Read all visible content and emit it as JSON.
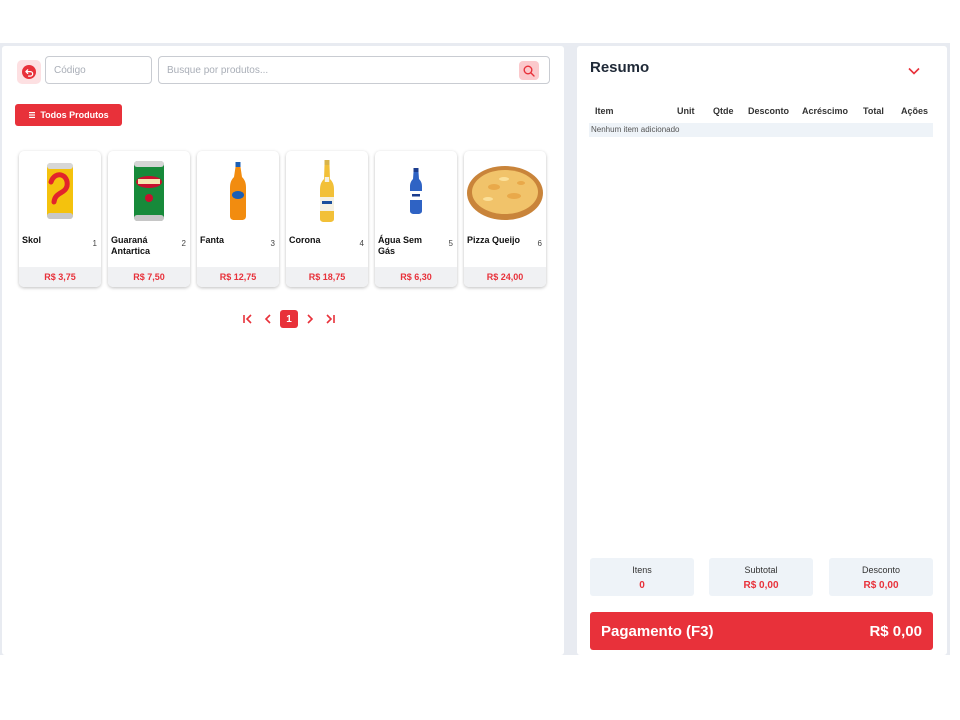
{
  "toolbar": {
    "code_placeholder": "Código",
    "search_placeholder": "Busque por produtos...",
    "all_products_label": "Todos Produtos"
  },
  "products": [
    {
      "name": "Skol",
      "code": "1",
      "price": "R$ 3,75",
      "icon": "skol-can-image"
    },
    {
      "name": "Guaraná Antartica",
      "code": "2",
      "price": "R$ 7,50",
      "icon": "guarana-can-image"
    },
    {
      "name": "Fanta",
      "code": "3",
      "price": "R$ 12,75",
      "icon": "fanta-bottle-image"
    },
    {
      "name": "Corona",
      "code": "4",
      "price": "R$ 18,75",
      "icon": "corona-bottle-image"
    },
    {
      "name": "Água Sem Gás",
      "code": "5",
      "price": "R$ 6,30",
      "icon": "water-bottle-image"
    },
    {
      "name": "Pizza Queijo",
      "code": "6",
      "price": "R$ 24,00",
      "icon": "pizza-image"
    }
  ],
  "pagination": {
    "current_page": "1"
  },
  "summary": {
    "title": "Resumo",
    "columns": [
      "Item",
      "Unit",
      "Qtde",
      "Desconto",
      "Acréscimo",
      "Total",
      "Ações"
    ],
    "empty_text": "Nenhum item adicionado",
    "stats": [
      {
        "label": "Itens",
        "value": "0"
      },
      {
        "label": "Subtotal",
        "value": "R$ 0,00"
      },
      {
        "label": "Desconto",
        "value": "R$ 0,00"
      }
    ],
    "payment_label": "Pagamento (F3)",
    "payment_total": "R$ 0,00"
  },
  "colors": {
    "accent": "#e8313a",
    "accent_light": "#fde0e2",
    "panel_bg": "#eef3f8"
  }
}
